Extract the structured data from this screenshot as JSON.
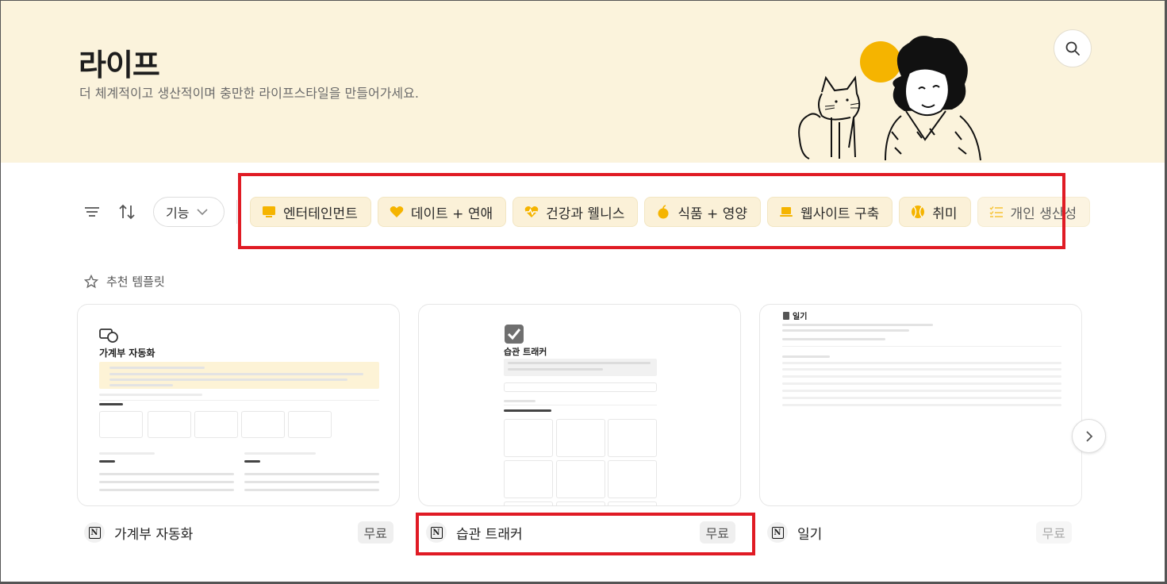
{
  "header": {
    "title": "라이프",
    "subtitle": "더 체계적이고 생산적이며 충만한 라이프스타일을 만들어가세요."
  },
  "toolbar": {
    "filter_label": "기능"
  },
  "categories": [
    {
      "label": "엔터테인먼트",
      "icon": "tv-icon"
    },
    {
      "label": "데이트 + 연애",
      "icon": "heart-icon"
    },
    {
      "label": "건강과 웰니스",
      "icon": "heartbeat-icon"
    },
    {
      "label": "식품 + 영양",
      "icon": "apple-icon"
    },
    {
      "label": "웹사이트 구축",
      "icon": "laptop-icon"
    },
    {
      "label": "취미",
      "icon": "ball-icon"
    },
    {
      "label": "개인 생산성",
      "icon": "checklist-icon"
    }
  ],
  "featured_label": "추천 템플릿",
  "templates": [
    {
      "title": "가계부 자동화",
      "price": "무료",
      "preview_title": "가계부 자동화"
    },
    {
      "title": "습관 트래커",
      "price": "무료",
      "preview_title": "습관 트래커"
    },
    {
      "title": "일기",
      "price": "무료",
      "preview_title": "일기"
    }
  ],
  "colors": {
    "hero_bg": "#fbf3dc",
    "chip_bg": "#fbf1d8",
    "accent_icon": "#f5b400",
    "highlight_red": "#e01b24"
  }
}
